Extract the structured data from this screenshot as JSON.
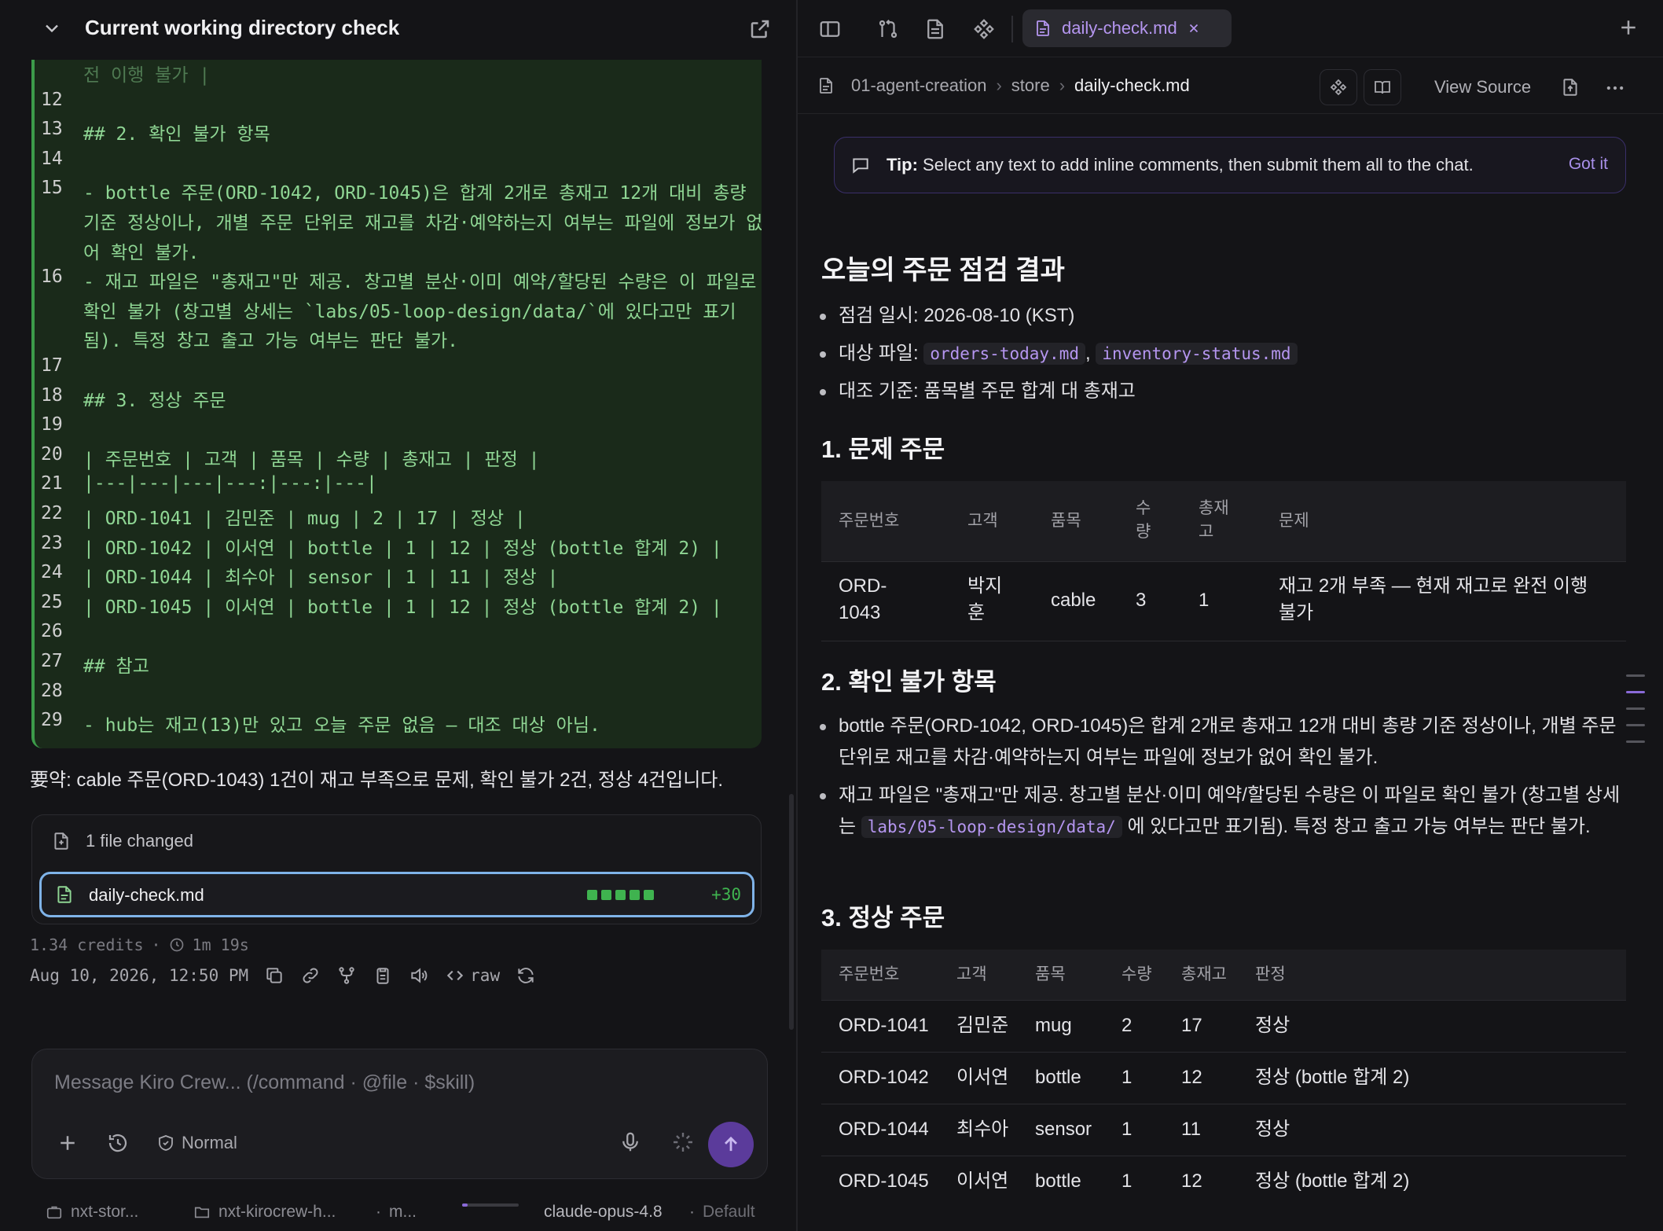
{
  "left": {
    "title": "Current working directory check",
    "code_lines": [
      {
        "n": "",
        "t": "전 이행 불가 |",
        "faded": true
      },
      {
        "n": "12",
        "t": ""
      },
      {
        "n": "13",
        "t": "## 2. 확인 불가 항목"
      },
      {
        "n": "14",
        "t": ""
      },
      {
        "n": "15",
        "t": "- bottle 주문(ORD-1042, ORD-1045)은 합계 2개로 총재고 12개 대비 총량"
      },
      {
        "n": "",
        "t": "기준 정상이나, 개별 주문 단위로 재고를 차감·예약하는지 여부는 파일에 정보가 없"
      },
      {
        "n": "",
        "t": "어 확인 불가."
      },
      {
        "n": "16",
        "t": "- 재고 파일은 \"총재고\"만 제공. 창고별 분산·이미 예약/할당된 수량은 이 파일로"
      },
      {
        "n": "",
        "t": "확인 불가 (창고별 상세는 `labs/05-loop-design/data/`에 있다고만 표기"
      },
      {
        "n": "",
        "t": "됨). 특정 창고 출고 가능 여부는 판단 불가."
      },
      {
        "n": "17",
        "t": ""
      },
      {
        "n": "18",
        "t": "## 3. 정상 주문"
      },
      {
        "n": "19",
        "t": ""
      },
      {
        "n": "20",
        "t": "| 주문번호 | 고객 | 품목 | 수량 | 총재고 | 판정 |"
      },
      {
        "n": "21",
        "t": "|---|---|---|---:|---:|---|"
      },
      {
        "n": "22",
        "t": "| ORD-1041 | 김민준 | mug | 2 | 17 | 정상 |"
      },
      {
        "n": "23",
        "t": "| ORD-1042 | 이서연 | bottle | 1 | 12 | 정상 (bottle 합계 2) |"
      },
      {
        "n": "24",
        "t": "| ORD-1044 | 최수아 | sensor | 1 | 11 | 정상 |"
      },
      {
        "n": "25",
        "t": "| ORD-1045 | 이서연 | bottle | 1 | 12 | 정상 (bottle 합계 2) |"
      },
      {
        "n": "26",
        "t": ""
      },
      {
        "n": "27",
        "t": "## 참고"
      },
      {
        "n": "28",
        "t": ""
      },
      {
        "n": "29",
        "t": "- hub는 재고(13)만 있고 오늘 주문 없음 — 대조 대상 아님."
      }
    ],
    "summary": "要약: cable 주문(ORD-1043) 1건이 재고 부족으로 문제, 확인 불가 2건, 정상 4건입니다.",
    "files_changed": "1 file changed",
    "file_name": "daily-check.md",
    "file_additions": "+30",
    "credits": "1.34 credits",
    "duration": "1m 19s",
    "timestamp": "Aug 10, 2026, 12:50 PM",
    "raw_label": "raw",
    "composer_placeholder": "Message Kiro Crew... (/command · @file · $skill)",
    "mode_label": "Normal",
    "status": {
      "workspace": "nxt-stor...",
      "folder": "nxt-kirocrew-h...",
      "branch": "m...",
      "model": "claude-opus-4.8",
      "profile": "Default",
      "progress": 0.1
    }
  },
  "right": {
    "tab_label": "daily-check.md",
    "breadcrumb": [
      "01-agent-creation",
      "store",
      "daily-check.md"
    ],
    "view_source": "View Source",
    "tip_bold": "Tip:",
    "tip_text": " Select any text to add inline comments, then submit them all to the chat.",
    "tip_action": "Got it",
    "doc": {
      "title": "오늘의 주문 점검 결과",
      "meta_date": "점검 일시: 2026-08-10 (KST)",
      "meta_files_prefix": "대상 파일: ",
      "meta_file1": "orders-today.md",
      "meta_file_sep": ", ",
      "meta_file2": "inventory-status.md",
      "meta_basis": "대조 기준: 품목별 주문 합계 대 총재고",
      "s1": "1. 문제 주문",
      "t1_headers": [
        "주문번호",
        "고객",
        "품목",
        "수\n량",
        "총재\n고",
        "문제"
      ],
      "t1_row": [
        "ORD-\n1043",
        "박지\n훈",
        "cable",
        "3",
        "1",
        "재고 2개 부족 — 현재 재고로 완전 이행\n불가"
      ],
      "s2": "2. 확인 불가 항목",
      "s2_b1": "bottle 주문(ORD-1042, ORD-1045)은 합계 2개로 총재고 12개 대비 총량 기준 정상이나, 개별 주문 단위로 재고를 차감·예약하는지 여부는 파일에 정보가 없어 확인 불가.",
      "s2_b2_a": "재고 파일은 \"총재고\"만 제공. 창고별 분산·이미 예약/할당된 수량은 이 파일로 확인 불가 (창고별 상세는 ",
      "s2_b2_code": "labs/05-loop-design/data/",
      "s2_b2_b": " 에 있다고만 표기됨). 특정 창고 출고 가능 여부는 판단 불가.",
      "s3": "3. 정상 주문",
      "t3_headers": [
        "주문번호",
        "고객",
        "품목",
        "수량",
        "총재고",
        "판정"
      ],
      "t3_rows": [
        [
          "ORD-1041",
          "김민준",
          "mug",
          "2",
          "17",
          "정상"
        ],
        [
          "ORD-1042",
          "이서연",
          "bottle",
          "1",
          "12",
          "정상 (bottle 합계 2)"
        ],
        [
          "ORD-1044",
          "최수아",
          "sensor",
          "1",
          "11",
          "정상"
        ],
        [
          "ORD-1045",
          "이서연",
          "bottle",
          "1",
          "12",
          "정상 (bottle 합계 2)"
        ]
      ]
    }
  }
}
